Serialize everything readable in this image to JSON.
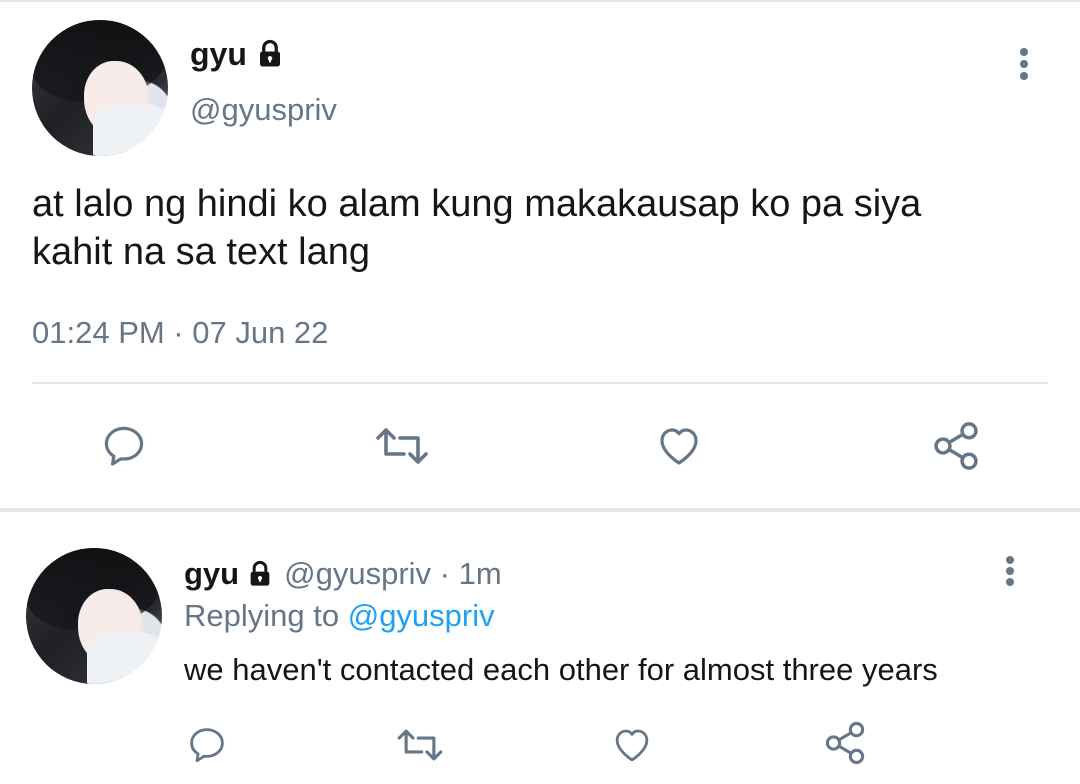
{
  "main_tweet": {
    "display_name": "gyu",
    "handle": "@gyuspriv",
    "text_line1": "at lalo ng hindi ko alam kung makakausap ko pa siya",
    "text_line2": "kahit na sa text lang",
    "timestamp": "01:24 PM · 07 Jun 22",
    "icons": [
      "lock-icon",
      "more-icon",
      "reply-icon",
      "retweet-icon",
      "like-icon",
      "share-icon"
    ]
  },
  "reply_tweet": {
    "display_name": "gyu",
    "handle_time": "@gyuspriv · 1m",
    "replying_prefix": "Replying to",
    "replying_handle": "@gyuspriv",
    "text": "we haven't contacted each other for almost three years",
    "icons": [
      "lock-icon",
      "more-icon",
      "reply-icon",
      "retweet-icon",
      "like-icon",
      "share-icon"
    ]
  },
  "colors": {
    "text": "#14171a",
    "muted": "#657786",
    "link": "#1da1f2",
    "divider": "#e1e8ed"
  }
}
